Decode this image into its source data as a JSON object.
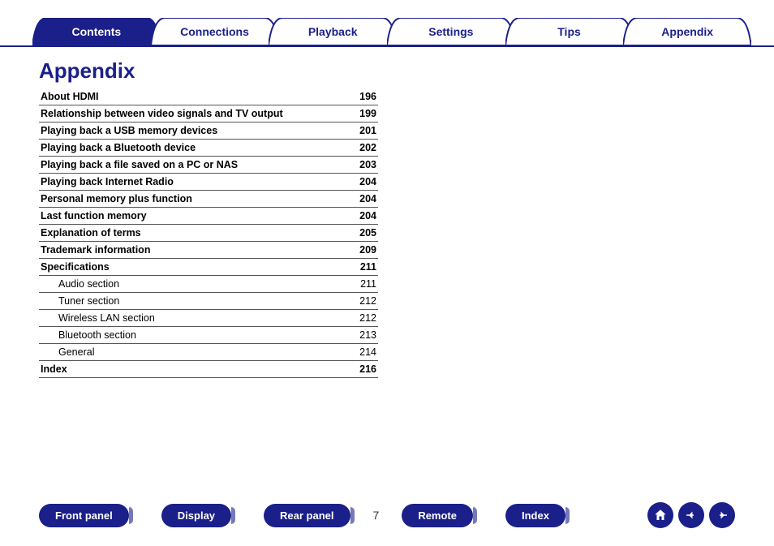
{
  "tabs": [
    {
      "label": "Contents",
      "active": true
    },
    {
      "label": "Connections",
      "active": false
    },
    {
      "label": "Playback",
      "active": false
    },
    {
      "label": "Settings",
      "active": false
    },
    {
      "label": "Tips",
      "active": false
    },
    {
      "label": "Appendix",
      "active": false
    }
  ],
  "page_title": "Appendix",
  "toc": [
    {
      "label": "About HDMI",
      "page": "196",
      "level": 0
    },
    {
      "label": "Relationship between video signals and TV output",
      "page": "199",
      "level": 0
    },
    {
      "label": "Playing back a USB memory devices",
      "page": "201",
      "level": 0
    },
    {
      "label": "Playing back a Bluetooth device",
      "page": "202",
      "level": 0
    },
    {
      "label": "Playing back a file saved on a PC or NAS",
      "page": "203",
      "level": 0
    },
    {
      "label": "Playing back Internet Radio",
      "page": "204",
      "level": 0
    },
    {
      "label": "Personal memory plus function",
      "page": "204",
      "level": 0
    },
    {
      "label": "Last function memory",
      "page": "204",
      "level": 0
    },
    {
      "label": "Explanation of terms",
      "page": "205",
      "level": 0
    },
    {
      "label": "Trademark information",
      "page": "209",
      "level": 0
    },
    {
      "label": "Specifications",
      "page": "211",
      "level": 0
    },
    {
      "label": "Audio section",
      "page": "211",
      "level": 1
    },
    {
      "label": "Tuner section",
      "page": "212",
      "level": 1
    },
    {
      "label": "Wireless LAN section",
      "page": "212",
      "level": 1
    },
    {
      "label": "Bluetooth section",
      "page": "213",
      "level": 1
    },
    {
      "label": "General",
      "page": "214",
      "level": 1
    },
    {
      "label": "Index",
      "page": "216",
      "level": 0
    }
  ],
  "bottom_buttons": {
    "front": "Front panel",
    "display": "Display",
    "rear": "Rear panel",
    "remote": "Remote",
    "index": "Index"
  },
  "page_number": "7"
}
